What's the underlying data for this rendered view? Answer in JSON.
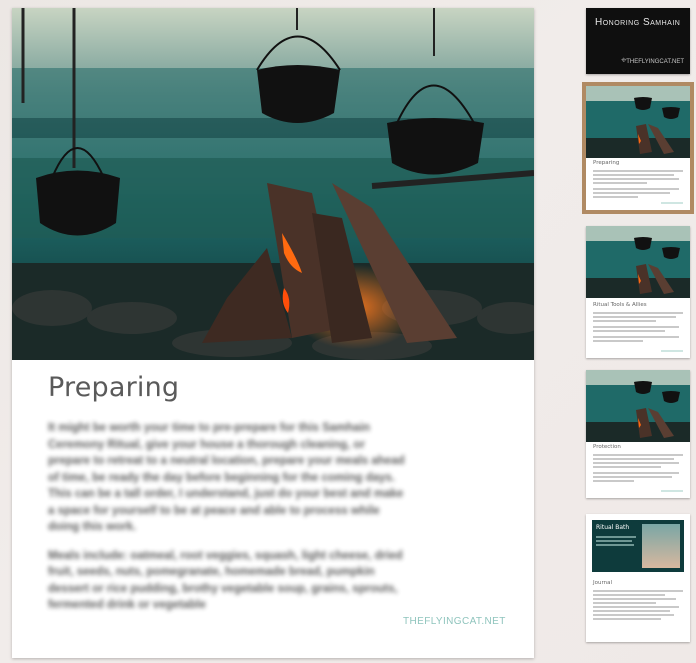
{
  "page": {
    "heading": "Preparing",
    "paragraphs": [
      "It might be worth your time to pre-prepare for this Samhain Ceremony Ritual, give your house a thorough cleaning, or prepare to retreat to a neutral location, prepare your meals ahead of time, be ready the day before beginning for the coming days. This can be a tall order, I understand, just do your best and make a space for yourself to be at peace and able to process while doing this work.",
      "Meals include: oatmeal, root veggies, squash, light cheese, dried fruit, seeds, nuts, pomegranate, homemade bread, pumpkin dessert or rice pudding, brothy vegetable soup, grains, sprouts, fermented drink or vegetable"
    ],
    "watermark": "THEFLYINGCAT.NET"
  },
  "thumbnails": [
    {
      "title": "Honoring Samhain",
      "site": "THEFLYINGCAT.NET",
      "selected": false
    },
    {
      "title": "Preparing",
      "selected": true
    },
    {
      "title": "Ritual Tools & Allies",
      "selected": false
    },
    {
      "title": "Protection",
      "selected": false
    },
    {
      "title": "Ritual Bath",
      "subtitle": "Journal",
      "selected": false
    }
  ],
  "colors": {
    "selected_outline": "#b08a63",
    "accent": "#8fc4bd",
    "heading": "#5a5a5a"
  }
}
